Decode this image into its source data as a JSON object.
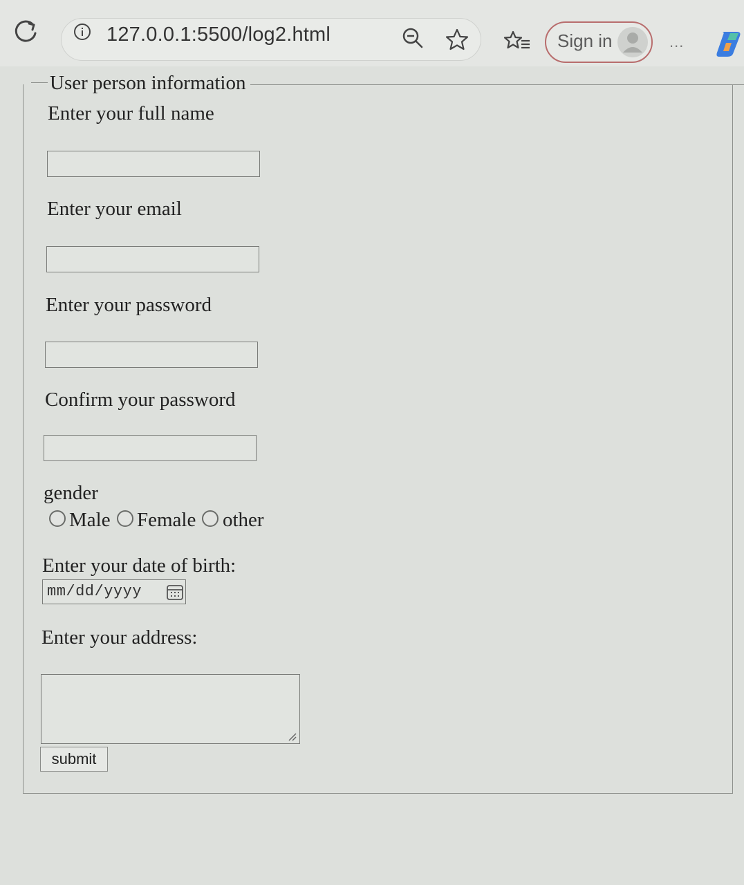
{
  "browser": {
    "url": "127.0.0.1:5500/log2.html",
    "sign_in_label": "Sign in",
    "more_label": "..."
  },
  "form": {
    "legend": "User person information",
    "full_name_label": "Enter your full name",
    "full_name_value": "",
    "email_label": "Enter your email",
    "email_value": "",
    "password_label": "Enter your password",
    "password_value": "",
    "confirm_password_label": "Confirm your password",
    "confirm_password_value": "",
    "gender_label": "gender",
    "gender_options": [
      "Male",
      "Female",
      "other"
    ],
    "dob_label": "Enter your date of birth:",
    "dob_placeholder": "mm/dd/yyyy",
    "address_label": "Enter your address:",
    "address_value": "",
    "submit_label": "submit"
  },
  "colors": {
    "sign_in_border": "#b86d6d",
    "page_background": "#dde0dc"
  }
}
